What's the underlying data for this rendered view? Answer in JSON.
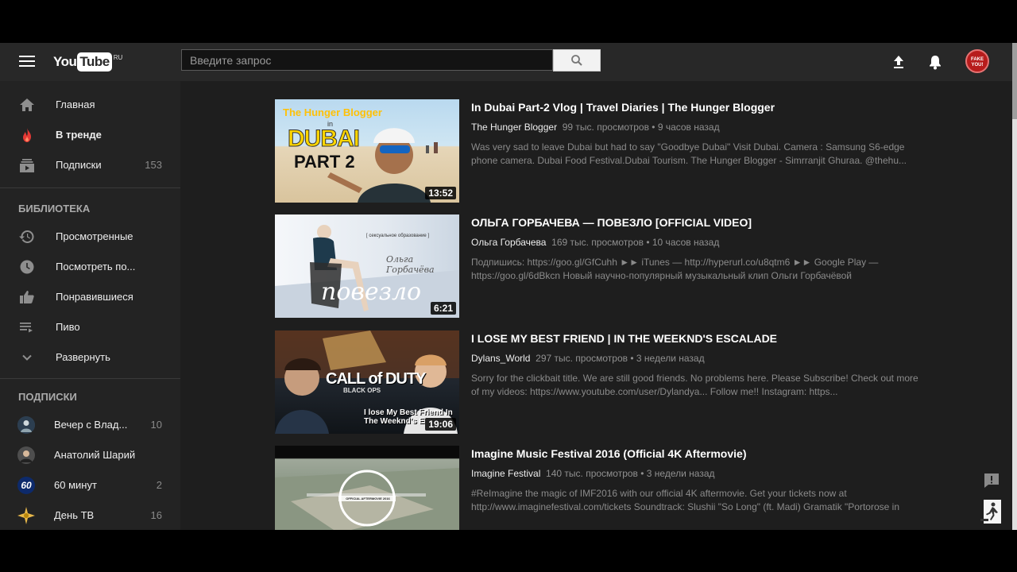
{
  "header": {
    "logo_you": "You",
    "logo_tube": "Tube",
    "logo_country": "RU",
    "search_placeholder": "Введите запрос",
    "avatar_text": "FAKE YOU!"
  },
  "sidebar": {
    "main": [
      {
        "label": "Главная",
        "icon": "home-icon"
      },
      {
        "label": "В тренде",
        "icon": "trending-flame-icon"
      },
      {
        "label": "Подписки",
        "icon": "subscriptions-icon",
        "count": "153"
      }
    ],
    "library_title": "БИБЛИОТЕКА",
    "library": [
      {
        "label": "Просмотренные",
        "icon": "history-icon"
      },
      {
        "label": "Посмотреть по...",
        "icon": "watch-later-clock-icon"
      },
      {
        "label": "Понравившиеся",
        "icon": "thumbs-up-icon"
      },
      {
        "label": "Пиво",
        "icon": "playlist-icon"
      },
      {
        "label": "Развернуть",
        "icon": "chevron-down-icon"
      }
    ],
    "subs_title": "ПОДПИСКИ",
    "subs": [
      {
        "label": "Вечер с Влад...",
        "count": "10"
      },
      {
        "label": "Анатолий Шарий",
        "count": ""
      },
      {
        "label": "60 минут",
        "count": "2",
        "avatar_text": "60"
      },
      {
        "label": "День ТВ",
        "count": "16"
      }
    ]
  },
  "videos": [
    {
      "title": "In Dubai Part-2 Vlog | Travel Diaries | The Hunger Blogger",
      "channel": "The Hunger Blogger",
      "stats": "99 тыс. просмотров • 9 часов назад",
      "description": "Was very sad to leave Dubai but had to say \"Goodbye Dubai\" Visit Dubai. Camera : Samsung S6-edge phone camera. Dubai Food Festival.Dubai Tourism. The Hunger Blogger - Simrranjit Ghuraa. @thehu...",
      "duration": "13:52",
      "thumb_text_top": "The Hunger Blogger",
      "thumb_text_in": "in",
      "thumb_text_main": "DUBAI",
      "thumb_text_part": "PART 2"
    },
    {
      "title": "ОЛЬГА ГОРБАЧЕВА — ПОВЕЗЛО [OFFICIAL VIDEO]",
      "channel": "Ольга Горбачева",
      "stats": "169 тыс. просмотров • 10 часов назад",
      "description": "Подпишись: https://goo.gl/GfCuhh ►► iTunes — http://hyperurl.co/u8qtm6 ►► Google Play — https://goo.gl/6dBkcn Новый научно-популярный музыкальный клип Ольги Горбачёвой",
      "duration": "6:21",
      "thumb_text_tag": "[ сексуальное образование ]",
      "thumb_text_name": "Ольга Горбачёва",
      "thumb_text_main": "повезло"
    },
    {
      "title": "I LOSE MY BEST FRIEND | IN THE WEEKND'S ESCALADE",
      "channel": "Dylans_World",
      "stats": "297 тыс. просмотров • 3 недели назад",
      "description": "Sorry for the clickbait title. We are still good friends. No problems here. Please Subscribe! Check out more of my videos: https://www.youtube.com/user/Dylandya... Follow me!! Instagram: https...",
      "duration": "19:06",
      "thumb_text_main": "CALL of DUTY",
      "thumb_text_sub": "BLACK OPS",
      "thumb_text_caption": "I lose My Best Friend In The Weeknd's E"
    },
    {
      "title": "Imagine Music Festival 2016 (Official 4K Aftermovie)",
      "channel": "Imagine Festival",
      "stats": "140 тыс. просмотров • 3 недели назад",
      "description": "#ReImagine the magic of IMF2016 with our official 4K aftermovie. Get your tickets now at http://www.imaginefestival.com/tickets Soundtrack: Slushii \"So Long\" (ft. Madi) Gramatik \"Portorose in",
      "duration": "",
      "thumb_text_badge": "OFFICIAL AFTERMOVIE 2016"
    }
  ],
  "colors": {
    "background": "#1e1e1e",
    "masthead": "#282828",
    "sidebar": "#232323",
    "trending_red": "#e53935",
    "muted_text": "#909090"
  }
}
